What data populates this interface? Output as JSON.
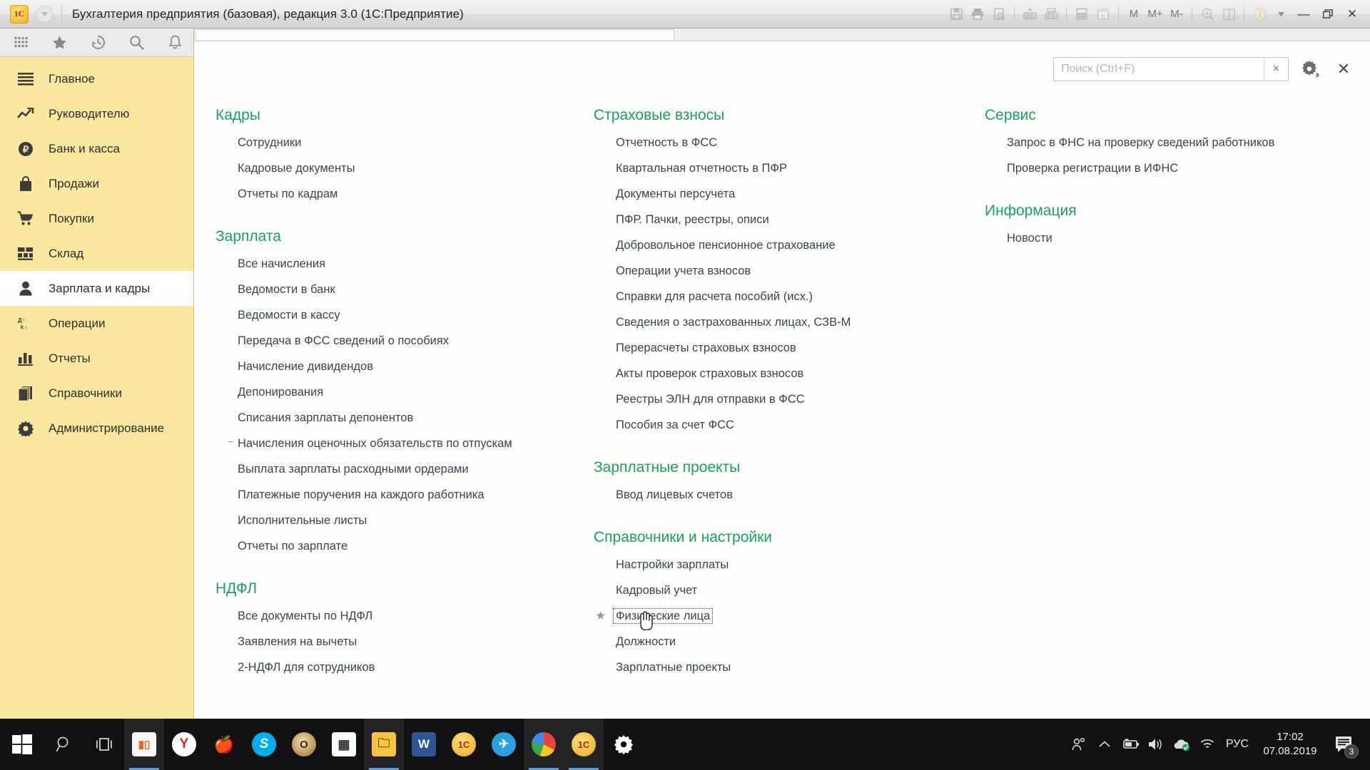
{
  "window": {
    "title": "Бухгалтерия предприятия (базовая), редакция 3.0  (1С:Предприятие)",
    "logo_text": "1С",
    "toolbar_icons": [
      "save-icon",
      "print-icon",
      "print-preview-icon",
      "link-in-icon",
      "link-out-icon",
      "calculator-icon",
      "calendar-icon"
    ],
    "memory_buttons": [
      "M",
      "M+",
      "M-"
    ],
    "extra_icons": [
      "zoom-icon",
      "split-window-icon",
      "info-icon",
      "info-dropdown-icon"
    ],
    "controls": {
      "minimize": "—",
      "restore": "❐",
      "close": "✕"
    }
  },
  "navpanel": {
    "tools": [
      "apps-grid-icon",
      "favorites-star-icon",
      "history-clock-icon",
      "search-icon",
      "notifications-bell-icon"
    ],
    "items": [
      {
        "label": "Главное",
        "icon": "menu-lines-icon",
        "active": false
      },
      {
        "label": "Руководителю",
        "icon": "trend-up-icon",
        "active": false
      },
      {
        "label": "Банк и касса",
        "icon": "ruble-circle-icon",
        "active": false
      },
      {
        "label": "Продажи",
        "icon": "shopping-bag-icon",
        "active": false
      },
      {
        "label": "Покупки",
        "icon": "shopping-cart-icon",
        "active": false
      },
      {
        "label": "Склад",
        "icon": "warehouse-grid-icon",
        "active": false
      },
      {
        "label": "Зарплата и кадры",
        "icon": "person-icon",
        "active": true
      },
      {
        "label": "Операции",
        "icon": "debit-credit-icon",
        "active": false
      },
      {
        "label": "Отчеты",
        "icon": "bar-chart-icon",
        "active": false
      },
      {
        "label": "Справочники",
        "icon": "books-icon",
        "active": false
      },
      {
        "label": "Администрирование",
        "icon": "gear-icon",
        "active": false
      }
    ]
  },
  "search": {
    "placeholder": "Поиск (Ctrl+F)",
    "value": "",
    "clear_label": "×",
    "gear_name": "settings-gear-icon",
    "close_label": "✕"
  },
  "columns": [
    {
      "sections": [
        {
          "title": "Кадры",
          "links": [
            {
              "label": "Сотрудники"
            },
            {
              "label": "Кадровые документы"
            },
            {
              "label": "Отчеты по кадрам"
            }
          ]
        },
        {
          "title": "Зарплата",
          "links": [
            {
              "label": "Все начисления"
            },
            {
              "label": "Ведомости в банк"
            },
            {
              "label": "Ведомости в кассу"
            },
            {
              "label": "Передача в ФСС сведений о пособиях"
            },
            {
              "label": "Начисление дивидендов"
            },
            {
              "label": "Депонирования"
            },
            {
              "label": "Списания зарплаты депонентов"
            },
            {
              "label": "Начисления оценочных обязательств по отпускам",
              "marked": true
            },
            {
              "label": "Выплата зарплаты расходными ордерами"
            },
            {
              "label": "Платежные поручения на каждого работника"
            },
            {
              "label": "Исполнительные листы"
            },
            {
              "label": "Отчеты по зарплате"
            }
          ]
        },
        {
          "title": "НДФЛ",
          "links": [
            {
              "label": "Все документы по НДФЛ"
            },
            {
              "label": "Заявления на вычеты"
            },
            {
              "label": "2-НДФЛ для сотрудников"
            }
          ]
        }
      ]
    },
    {
      "sections": [
        {
          "title": "Страховые взносы",
          "links": [
            {
              "label": "Отчетность в ФСС"
            },
            {
              "label": "Квартальная отчетность в ПФР"
            },
            {
              "label": "Документы персучета"
            },
            {
              "label": "ПФР. Пачки, реестры, описи"
            },
            {
              "label": "Добровольное пенсионное страхование"
            },
            {
              "label": "Операции учета взносов"
            },
            {
              "label": "Справки для расчета пособий (исх.)"
            },
            {
              "label": "Сведения о застрахованных лицах, СЗВ-М"
            },
            {
              "label": "Перерасчеты страховых взносов"
            },
            {
              "label": "Акты проверок страховых взносов"
            },
            {
              "label": "Реестры ЭЛН для отправки в ФСС"
            },
            {
              "label": "Пособия за счет ФСС"
            }
          ]
        },
        {
          "title": "Зарплатные проекты",
          "links": [
            {
              "label": "Ввод лицевых счетов"
            }
          ]
        },
        {
          "title": "Справочники и настройки",
          "links": [
            {
              "label": "Настройки зарплаты"
            },
            {
              "label": "Кадровый учет"
            },
            {
              "label": "Физические лица",
              "favorite": true,
              "focused": true,
              "cursor": true
            },
            {
              "label": "Должности"
            },
            {
              "label": "Зарплатные проекты"
            }
          ]
        }
      ]
    },
    {
      "sections": [
        {
          "title": "Сервис",
          "links": [
            {
              "label": "Запрос в ФНС на проверку сведений работников"
            },
            {
              "label": "Проверка регистрации в ИФНС"
            }
          ]
        },
        {
          "title": "Информация",
          "links": [
            {
              "label": "Новости"
            }
          ]
        }
      ]
    }
  ],
  "taskbar": {
    "start_name": "windows-start-icon",
    "buttons": [
      "search-icon",
      "task-view-icon"
    ],
    "apps": [
      {
        "name": "app-icon-orange-chart",
        "open": true,
        "glyph": "▯"
      },
      {
        "name": "app-icon-yandex",
        "open": false,
        "glyph": "Y"
      },
      {
        "name": "app-icon-apple",
        "open": false,
        "glyph": "🍎"
      },
      {
        "name": "app-icon-skype",
        "open": false,
        "glyph": "S"
      },
      {
        "name": "app-icon-opera",
        "open": false,
        "glyph": "O"
      },
      {
        "name": "app-icon-calculator",
        "open": false,
        "glyph": "▦"
      },
      {
        "name": "app-icon-explorer",
        "open": true,
        "glyph": "🗀"
      },
      {
        "name": "app-icon-word",
        "open": false,
        "glyph": "W"
      },
      {
        "name": "app-icon-1c-yellow",
        "open": false,
        "glyph": "1С"
      },
      {
        "name": "app-icon-telegram",
        "open": false,
        "glyph": "✈"
      },
      {
        "name": "app-icon-chrome",
        "open": true,
        "glyph": "◍"
      },
      {
        "name": "app-icon-1c-active",
        "open": true,
        "glyph": "1С"
      },
      {
        "name": "app-icon-settings-gear",
        "open": false,
        "glyph": "✾"
      }
    ],
    "tray": {
      "icons": [
        "people-icon",
        "show-hidden-chevron-icon",
        "battery-icon",
        "volume-icon",
        "onedrive-icon",
        "wifi-icon"
      ],
      "language": "РУС",
      "time": "17:02",
      "date": "07.08.2019",
      "notification_count": "3",
      "notification_name": "action-center-icon"
    }
  }
}
